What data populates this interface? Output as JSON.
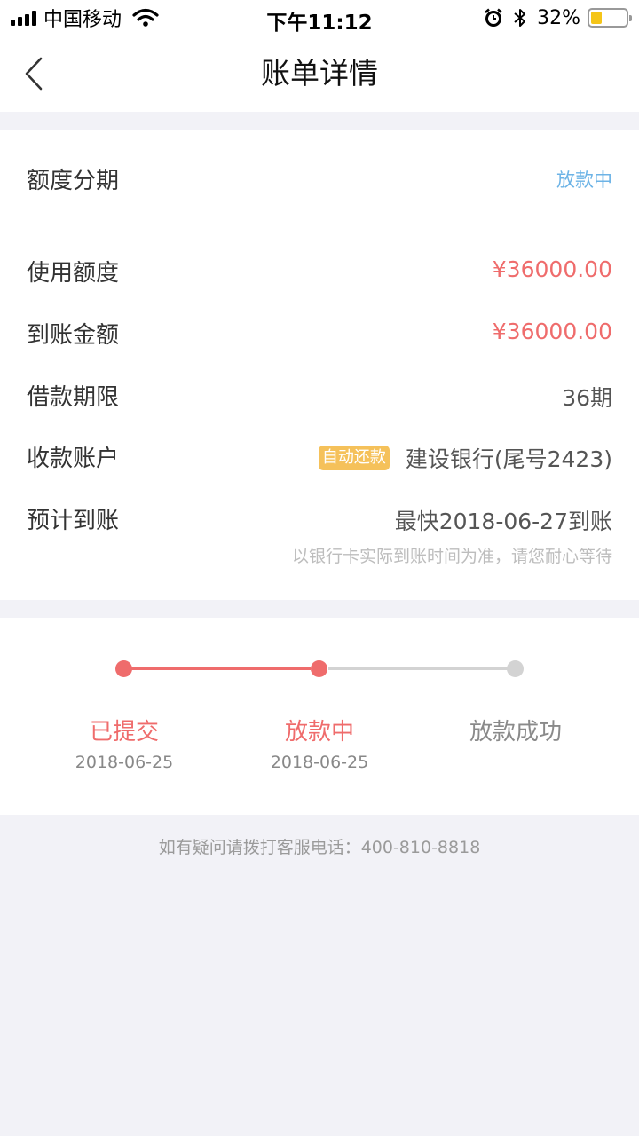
{
  "status_bar": {
    "carrier": "中国移动",
    "time": "下午11:12",
    "battery_pct": "32%",
    "icons": [
      "signal-icon",
      "wifi-icon",
      "alarm-icon",
      "bluetooth-icon",
      "battery-icon"
    ],
    "battery_level": 0.32
  },
  "nav": {
    "title": "账单详情",
    "back_icon": "chevron-left-icon"
  },
  "bill": {
    "type_label": "额度分期",
    "type_status": "放款中",
    "rows": [
      {
        "label": "使用额度",
        "value": "¥36000.00"
      },
      {
        "label": "到账金额",
        "value": "¥36000.00"
      },
      {
        "label": "借款期限",
        "value": "36期"
      },
      {
        "label": "收款账户",
        "badge": "自动还款",
        "value": "建设银行(尾号2423)"
      },
      {
        "label": "预计到账",
        "value": "最快2018-06-27到账"
      }
    ],
    "note": "以银行卡实际到账时间为准，请您耐心等待"
  },
  "progress": {
    "steps": [
      {
        "title": "已提交",
        "date": "2018-06-25",
        "state": "done"
      },
      {
        "title": "放款中",
        "date": "2018-06-25",
        "state": "current"
      },
      {
        "title": "放款成功",
        "date": "",
        "state": "pending"
      }
    ]
  },
  "footer": {
    "hotline": "如有疑问请拨打客服电话：400-810-8818"
  },
  "colors": {
    "accent_red": "#ef6c6c",
    "status_blue": "#6cb3e6",
    "badge_yellow": "#f5c15a",
    "pending_gray": "#d3d3d3",
    "background": "#f2f2f7"
  }
}
